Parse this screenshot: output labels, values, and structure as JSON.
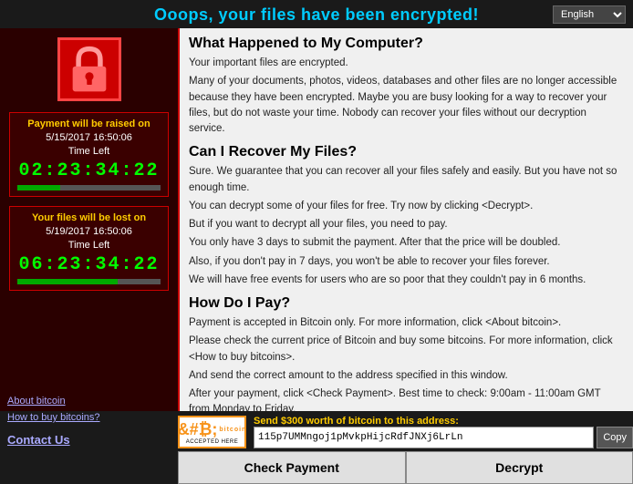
{
  "header": {
    "title": "Ooops, your files have been encrypted!",
    "lang_select": "English"
  },
  "left_panel": {
    "payment_box": {
      "title": "Payment will be raised on",
      "date": "5/15/2017 16:50:06",
      "time_left_label": "Time Left",
      "timer": "02:23:34:22",
      "progress": 30
    },
    "lost_box": {
      "title": "Your files will be lost on",
      "date": "5/19/2017 16:50:06",
      "time_left_label": "Time Left",
      "timer": "06:23:34:22",
      "progress": 70
    },
    "links": {
      "about_bitcoin": "About bitcoin",
      "how_to_buy": "How to buy bitcoins?",
      "contact_us": "Contact Us"
    }
  },
  "right_panel": {
    "section1": {
      "heading": "What Happened to My Computer?",
      "paragraphs": [
        "Your important files are encrypted.",
        "Many of your documents, photos, videos, databases and other files are no longer accessible because they have been encrypted. Maybe you are busy looking for a way to recover your files, but do not waste your time. Nobody can recover your files without our decryption service."
      ]
    },
    "section2": {
      "heading": "Can I Recover My Files?",
      "paragraphs": [
        "Sure. We guarantee that you can recover all your files safely and easily. But you have not so enough time.",
        "You can decrypt some of your files for free. Try now by clicking <Decrypt>.",
        "But if you want to decrypt all your files, you need to pay.",
        "You only have 3 days to submit the payment. After that the price will be doubled.",
        "Also, if you don't pay in 7 days, you won't be able to recover your files forever.",
        "We will have free events for users who are so poor that they couldn't pay in 6 months."
      ]
    },
    "section3": {
      "heading": "How Do I Pay?",
      "paragraphs": [
        "Payment is accepted in Bitcoin only. For more information, click <About bitcoin>.",
        "Please check the current price of Bitcoin and buy some bitcoins. For more information, click <How to buy bitcoins>.",
        "And send the correct amount to the address specified in this window.",
        "After your payment, click <Check Payment>. Best time to check: 9:00am - 11:00am GMT from Monday to Friday."
      ]
    }
  },
  "bitcoin_section": {
    "bitcoin_label_top": "bitcoin",
    "bitcoin_label_bottom": "ACCEPTED HERE",
    "send_label": "Send $300 worth of bitcoin to this address:",
    "address": "115p7UMMngoj1pMvkpHijcRdfJNXj6LrLn",
    "copy_label": "Copy"
  },
  "action_buttons": {
    "check_payment": "Check Payment",
    "decrypt": "Decrypt"
  }
}
